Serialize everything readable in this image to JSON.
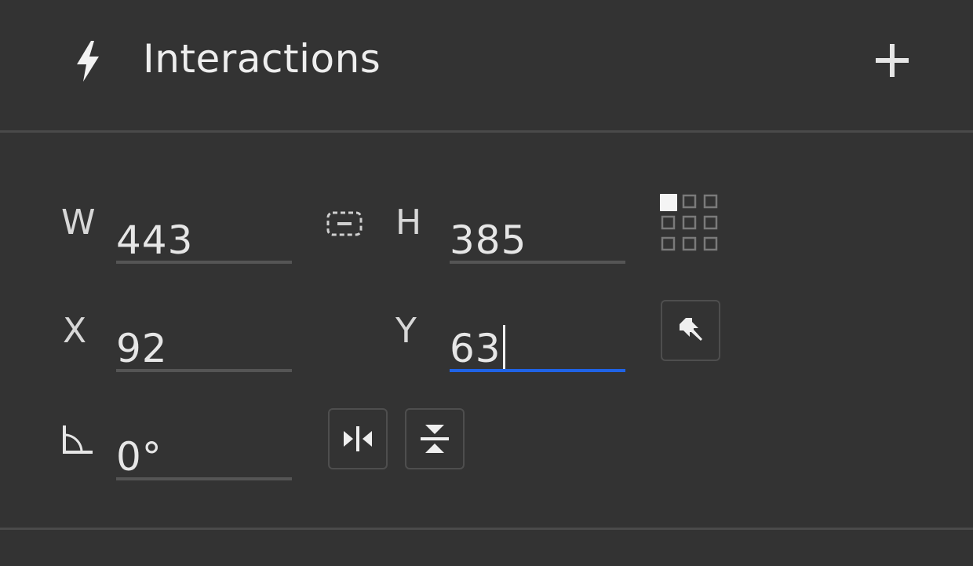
{
  "section": {
    "title": "Interactions",
    "icon": "bolt-icon",
    "add_icon": "plus-icon"
  },
  "transform": {
    "width": {
      "label": "W",
      "value": "443"
    },
    "height": {
      "label": "H",
      "value": "385"
    },
    "x": {
      "label": "X",
      "value": "92"
    },
    "y": {
      "label": "Y",
      "value": "63"
    },
    "rotation": {
      "icon": "angle-icon",
      "value": "0°"
    },
    "lock_icon": "link-aspect-icon",
    "anchor_icon": "anchor-grid-icon",
    "pin_icon": "pin-icon",
    "flip_horizontal_icon": "flip-horizontal-icon",
    "flip_vertical_icon": "flip-vertical-icon"
  },
  "colors": {
    "background": "#333333",
    "divider": "#4a4a4a",
    "active_underline": "#1f63e6",
    "text": "#e6e6e6"
  }
}
